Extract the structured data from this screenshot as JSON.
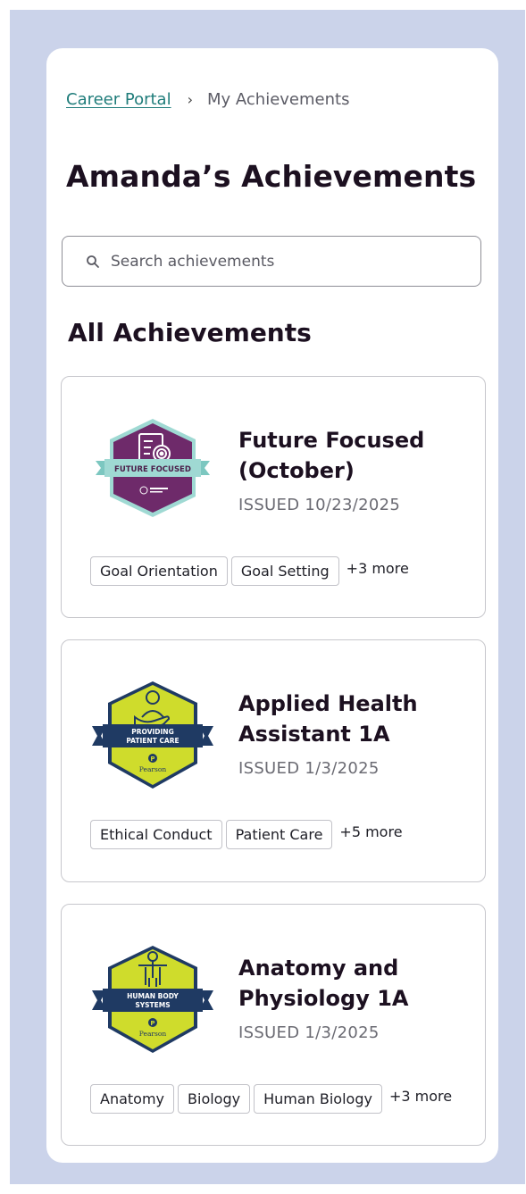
{
  "breadcrumb": {
    "link": "Career Portal",
    "separator": "›",
    "current": "My Achievements"
  },
  "page_title": "Amanda’s Achievements",
  "search": {
    "placeholder": "Search achievements"
  },
  "section_title": "All Achievements",
  "achievements": [
    {
      "title": "Future Focused (October)",
      "issued": "ISSUED 10/23/2025",
      "badge": {
        "label": "FUTURE FOCUSED",
        "icon": "checklist-target-icon",
        "colors": {
          "hex": "#6e2a6a",
          "ribbon": "#9fd9d3"
        }
      },
      "tags": [
        "Goal Orientation",
        "Goal Setting"
      ],
      "more": "+3 more"
    },
    {
      "title": "Applied Health Assistant 1A",
      "issued": "ISSUED 1/3/2025",
      "badge": {
        "label_line1": "PROVIDING",
        "label_line2": "PATIENT CARE",
        "brand": "Pearson",
        "icon": "hand-person-icon",
        "colors": {
          "hex": "#cfdc2c",
          "ribbon": "#1f3a63"
        }
      },
      "tags": [
        "Ethical Conduct",
        "Patient Care"
      ],
      "more": "+5 more"
    },
    {
      "title": "Anatomy and Physiology 1A",
      "issued": "ISSUED 1/3/2025",
      "badge": {
        "label_line1": "HUMAN BODY",
        "label_line2": "SYSTEMS",
        "brand": "Pearson",
        "icon": "human-body-icon",
        "colors": {
          "hex": "#cfdc2c",
          "ribbon": "#1f3a63"
        }
      },
      "tags": [
        "Anatomy",
        "Biology",
        "Human Biology"
      ],
      "more": "+3 more"
    }
  ]
}
